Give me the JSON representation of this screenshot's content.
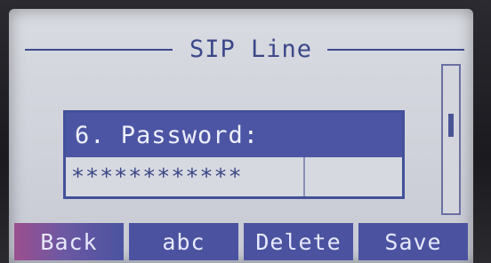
{
  "screen": {
    "title": "SIP Line"
  },
  "field": {
    "label": "6. Password:",
    "value": "************"
  },
  "softkeys": [
    {
      "label": "Back"
    },
    {
      "label": "abc"
    },
    {
      "label": "Delete"
    },
    {
      "label": "Save"
    }
  ],
  "colors": {
    "screen_background": "#d3d5dd",
    "highlight": "#4c55a3",
    "text_dark": "#3b4788",
    "text_light": "#eef0ff"
  }
}
